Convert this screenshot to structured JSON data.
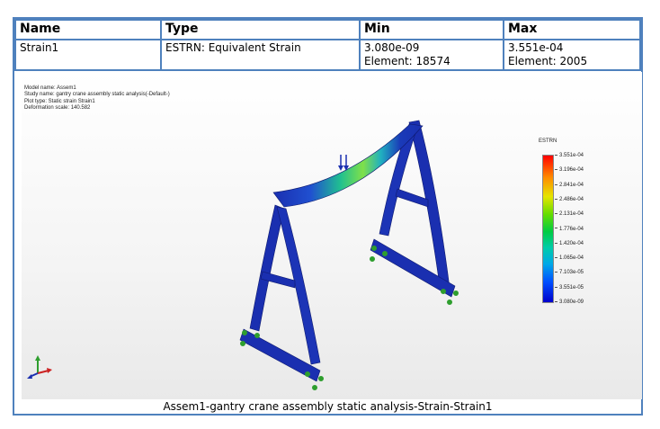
{
  "table": {
    "headers": [
      "Name",
      "Type",
      "Min",
      "Max"
    ],
    "row": {
      "name": "Strain1",
      "type": "ESTRN: Equivalent Strain",
      "min_value": "3.080e-09",
      "min_element": "Element: 18574",
      "max_value": "3.551e-04",
      "max_element": "Element: 2005"
    }
  },
  "plot_info": {
    "model_name": "Model name: Assem1",
    "study_name": "Study name: gantry crane assembly static analysis(-Default-)",
    "plot_type": "Plot type: Static strain Strain1",
    "deformation_scale": "Deformation scale: 140.582"
  },
  "legend": {
    "title": "ESTRN",
    "labels": [
      "3.551e-04",
      "3.196e-04",
      "2.841e-04",
      "2.486e-04",
      "2.131e-04",
      "1.776e-04",
      "1.420e-04",
      "1.065e-04",
      "7.103e-05",
      "3.551e-05",
      "3.080e-09"
    ],
    "colors": {
      "max": "#ff0000",
      "mid": "#00cc44",
      "min": "#0000cc"
    }
  },
  "caption": "Assem1-gantry crane assembly static analysis-Strain-Strain1",
  "colors": {
    "border": "#4f81bd",
    "beam_low": "#1a2fb0",
    "beam_high": "#7fe04a",
    "fixture": "#2e9e2e",
    "load_arrow": "#1a2fb0"
  },
  "icons": {
    "triad": "xyz-triad-icon",
    "load": "load-arrow-icon",
    "fixture": "fixture-icon"
  }
}
